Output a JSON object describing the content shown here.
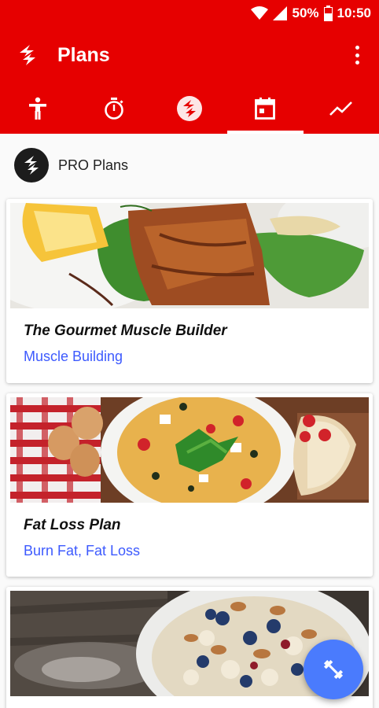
{
  "status_bar": {
    "battery": "50%",
    "time": "10:50",
    "icons": [
      "wifi-icon",
      "signal-icon",
      "battery-icon"
    ]
  },
  "app_bar": {
    "title": "Plans",
    "logo_icon": "freeletics-logo-icon",
    "menu_icon": "more-vert-icon"
  },
  "tabs": [
    {
      "icon": "person-icon",
      "active": false
    },
    {
      "icon": "stopwatch-icon",
      "active": false
    },
    {
      "icon": "freeletics-badge-icon",
      "active": false
    },
    {
      "icon": "calendar-icon",
      "active": true
    },
    {
      "icon": "trending-icon",
      "active": false
    }
  ],
  "section": {
    "title": "PRO Plans"
  },
  "plans": [
    {
      "title": "The Gourmet Muscle Builder",
      "subtitle": "Muscle Building",
      "image": "salmon-salad-photo"
    },
    {
      "title": "Fat Loss Plan",
      "subtitle": "Burn Fat, Fat Loss",
      "image": "omelette-eggs-photo"
    },
    {
      "title": "",
      "subtitle": "",
      "image": "porridge-blueberries-almonds-photo"
    }
  ],
  "fab": {
    "icon": "dumbbell-icon"
  },
  "colors": {
    "primary": "#e60000",
    "accent_link": "#3d5afe",
    "fab": "#4a7bfd"
  }
}
